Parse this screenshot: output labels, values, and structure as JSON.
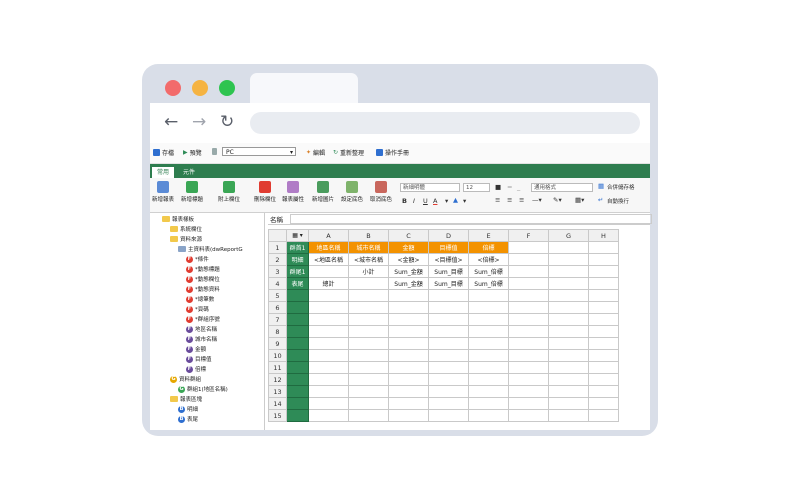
{
  "toolbar": {
    "save_label": "存檔",
    "preview_label": "預覽",
    "device_select": "PC",
    "edit_label": "編輯",
    "reorg_label": "重新整理",
    "manual_label": "操作手冊"
  },
  "ribbon_tabs": [
    "常用",
    "元件"
  ],
  "ribbon_buttons": [
    "新增報表",
    "新增標題",
    "附上欄位",
    "刪除欄位",
    "報表屬性",
    "新增圖片",
    "設定底色",
    "取消底色"
  ],
  "format": {
    "font_name": "新細明體",
    "font_size": "12",
    "number_format": "通用格式",
    "merge_label": "合併儲存格",
    "wrap_label": "自動換行",
    "bold": "B",
    "italic": "I",
    "underline": "U",
    "font_color": "A"
  },
  "name_bar": {
    "label": "名稱"
  },
  "tree": [
    {
      "label": "報表樣板",
      "level": 0,
      "icon": "folder"
    },
    {
      "label": "系統欄位",
      "level": 1,
      "icon": "folder"
    },
    {
      "label": "資料來源",
      "level": 1,
      "icon": "folder"
    },
    {
      "label": "主資料表(dwReportG",
      "level": 2,
      "icon": "table"
    },
    {
      "label": "*條件",
      "level": 3,
      "icon": "F",
      "color": "#e03c31"
    },
    {
      "label": "*動態標題",
      "level": 3,
      "icon": "F",
      "color": "#e03c31"
    },
    {
      "label": "*動態欄位",
      "level": 3,
      "icon": "F",
      "color": "#e03c31"
    },
    {
      "label": "*動態資料",
      "level": 3,
      "icon": "F",
      "color": "#e03c31"
    },
    {
      "label": "*總筆數",
      "level": 3,
      "icon": "F",
      "color": "#e03c31"
    },
    {
      "label": "*頁碼",
      "level": 3,
      "icon": "F",
      "color": "#e03c31"
    },
    {
      "label": "*群組序號",
      "level": 3,
      "icon": "F",
      "color": "#e03c31"
    },
    {
      "label": "地區名稱",
      "level": 3,
      "icon": "F",
      "color": "#6a4c9c"
    },
    {
      "label": "城市名稱",
      "level": 3,
      "icon": "F",
      "color": "#6a4c9c"
    },
    {
      "label": "金額",
      "level": 3,
      "icon": "F",
      "color": "#6a4c9c"
    },
    {
      "label": "目標值",
      "level": 3,
      "icon": "F",
      "color": "#6a4c9c"
    },
    {
      "label": "倍標",
      "level": 3,
      "icon": "F",
      "color": "#6a4c9c"
    },
    {
      "label": "資料群組",
      "level": 1,
      "icon": "G",
      "color": "#e6a700"
    },
    {
      "label": "群組1(地區名稱)",
      "level": 2,
      "icon": "G",
      "color": "#3aa655"
    },
    {
      "label": "報表區塊",
      "level": 1,
      "icon": "folder"
    },
    {
      "label": "明細",
      "level": 2,
      "icon": "B",
      "color": "#2f6fd0"
    },
    {
      "label": "表尾",
      "level": 2,
      "icon": "B",
      "color": "#2f6fd0"
    }
  ],
  "sheet": {
    "columns": [
      "A",
      "B",
      "C",
      "D",
      "E",
      "F",
      "G",
      "H"
    ],
    "rows": [
      {
        "num": "1",
        "label": "群首1",
        "cells": [
          "地區名稱",
          "城市名稱",
          "金額",
          "目標值",
          "倍標",
          "",
          "",
          ""
        ]
      },
      {
        "num": "2",
        "label": "明細",
        "cells": [
          "<地區名稱",
          "<城市名稱",
          "<金額>",
          "<目標值>",
          "<倍標>",
          "",
          "",
          ""
        ]
      },
      {
        "num": "3",
        "label": "群尾1",
        "cells": [
          "",
          "小計",
          "Sum_金額",
          "Sum_目標",
          "Sum_倍標",
          "",
          "",
          ""
        ]
      },
      {
        "num": "4",
        "label": "表尾",
        "cells": [
          "總計",
          "",
          "Sum_金額",
          "Sum_目標",
          "Sum_倍標",
          "",
          "",
          ""
        ]
      },
      {
        "num": "5",
        "label": "",
        "cells": [
          "",
          "",
          "",
          "",
          "",
          "",
          "",
          ""
        ]
      },
      {
        "num": "6",
        "label": "",
        "cells": [
          "",
          "",
          "",
          "",
          "",
          "",
          "",
          ""
        ]
      },
      {
        "num": "7",
        "label": "",
        "cells": [
          "",
          "",
          "",
          "",
          "",
          "",
          "",
          ""
        ]
      },
      {
        "num": "8",
        "label": "",
        "cells": [
          "",
          "",
          "",
          "",
          "",
          "",
          "",
          ""
        ]
      },
      {
        "num": "9",
        "label": "",
        "cells": [
          "",
          "",
          "",
          "",
          "",
          "",
          "",
          ""
        ]
      },
      {
        "num": "10",
        "label": "",
        "cells": [
          "",
          "",
          "",
          "",
          "",
          "",
          "",
          ""
        ]
      },
      {
        "num": "11",
        "label": "",
        "cells": [
          "",
          "",
          "",
          "",
          "",
          "",
          "",
          ""
        ]
      },
      {
        "num": "12",
        "label": "",
        "cells": [
          "",
          "",
          "",
          "",
          "",
          "",
          "",
          ""
        ]
      },
      {
        "num": "13",
        "label": "",
        "cells": [
          "",
          "",
          "",
          "",
          "",
          "",
          "",
          ""
        ]
      },
      {
        "num": "14",
        "label": "",
        "cells": [
          "",
          "",
          "",
          "",
          "",
          "",
          "",
          ""
        ]
      },
      {
        "num": "15",
        "label": "",
        "cells": [
          "",
          "",
          "",
          "",
          "",
          "",
          "",
          ""
        ]
      }
    ]
  },
  "colors": {
    "ribbon": "#2e7d4f",
    "header_orange": "#f39200",
    "row_header_green": "#2e8b57"
  }
}
